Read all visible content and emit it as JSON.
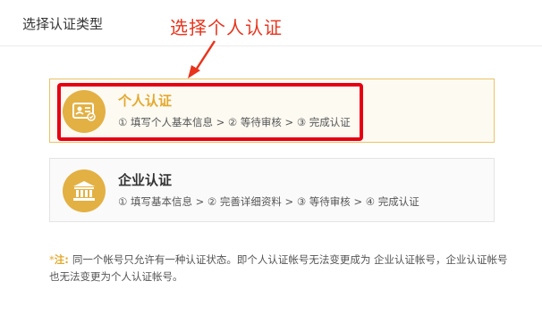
{
  "header": {
    "title": "选择认证类型"
  },
  "annotation": {
    "label": "选择个人认证",
    "color": "#e8341c"
  },
  "options": [
    {
      "title": "个人认证",
      "steps": "① 填写个人基本信息 > ② 等待审核 > ③ 完成认证",
      "icon": "id-card-icon",
      "selected": true
    },
    {
      "title": "企业认证",
      "steps": "① 填写基本信息 > ② 完善详细资料 > ③ 等待审核 > ④ 完成认证",
      "icon": "bank-building-icon",
      "selected": false
    }
  ],
  "note": {
    "star": "*",
    "label": "注:",
    "text": "同一个帐号只允许有一种认证状态。即个人认证帐号无法变更成为 企业认证帐号，企业认证帐号也无法变更为个人认证帐号。"
  },
  "colors": {
    "accent": "#e3b043",
    "highlight_box": "#e60012",
    "title_personal": "#e3a92f"
  }
}
